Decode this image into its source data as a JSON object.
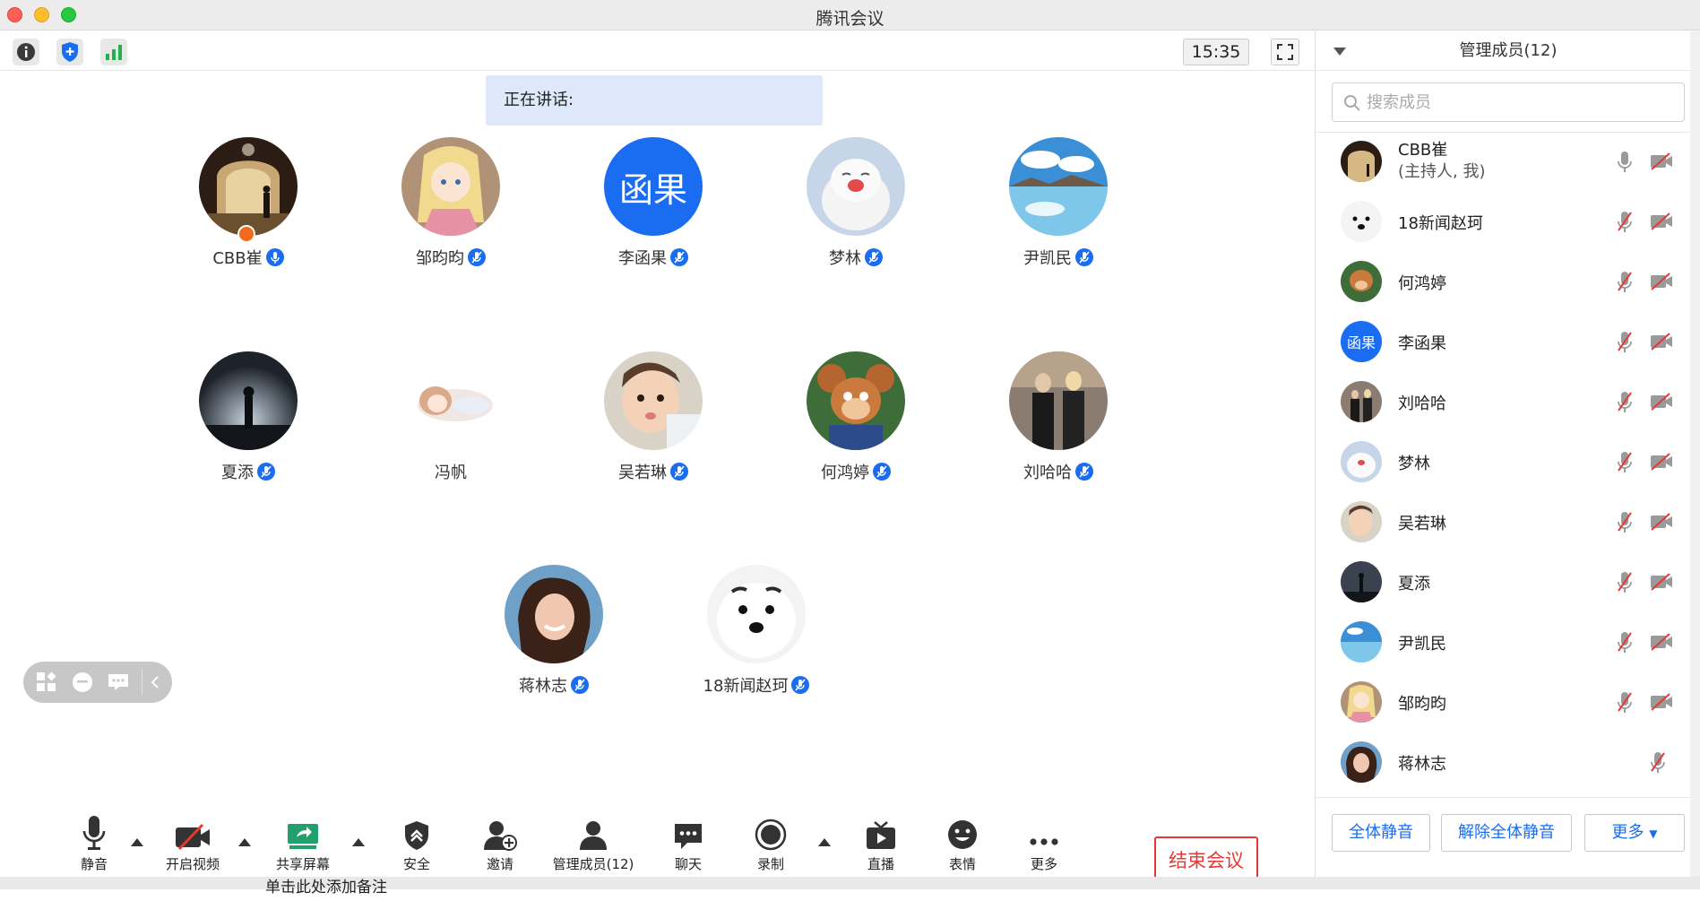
{
  "window": {
    "title": "腾讯会议"
  },
  "topbar": {
    "clock": "15:35",
    "icons": [
      "info-icon",
      "shield-icon",
      "signal-icon"
    ]
  },
  "speaking": {
    "label": "正在讲话:"
  },
  "participants": [
    {
      "name": "CBB崔",
      "avatar": "arch-photo",
      "host": true,
      "mic": "on"
    },
    {
      "name": "邹昀昀",
      "avatar": "anime-girl",
      "mic": "muted"
    },
    {
      "name": "李函果",
      "avatar_text": "函果",
      "avatar_color": "#1a6cf0",
      "mic": "muted"
    },
    {
      "name": "梦林",
      "avatar": "seal-photo",
      "mic": "muted"
    },
    {
      "name": "尹凯民",
      "avatar": "lake-photo",
      "mic": "muted"
    },
    {
      "name": "夏添",
      "avatar": "sunset-silhouette",
      "mic": "muted"
    },
    {
      "name": "冯帆",
      "avatar": "anime-lying",
      "mic": "none"
    },
    {
      "name": "吴若琳",
      "avatar": "child-photo",
      "mic": "muted"
    },
    {
      "name": "何鸿婷",
      "avatar": "jerry-mouse",
      "mic": "muted"
    },
    {
      "name": "刘哈哈",
      "avatar": "street-photo",
      "mic": "muted"
    },
    {
      "name": "蒋林志",
      "avatar": "smiling-woman",
      "mic": "muted"
    },
    {
      "name": "18新闻赵珂",
      "avatar": "white-dog",
      "mic": "muted"
    }
  ],
  "toolbar": {
    "mute": "静音",
    "video": "开启视频",
    "share": "共享屏幕",
    "security": "安全",
    "invite": "邀请",
    "members": "管理成员(12)",
    "chat": "聊天",
    "record": "录制",
    "live": "直播",
    "emoji": "表情",
    "more": "更多",
    "end": "结束会议"
  },
  "panel": {
    "title": "管理成员(12)",
    "search_placeholder": "搜索成员",
    "members": [
      {
        "name": "CBB崔",
        "sub": "(主持人, 我)",
        "avatar": "arch-photo"
      },
      {
        "name": "18新闻赵珂",
        "avatar": "white-dog"
      },
      {
        "name": "何鸿婷",
        "avatar": "jerry-mouse"
      },
      {
        "name": "李函果",
        "avatar_text": "函果"
      },
      {
        "name": "刘哈哈",
        "avatar": "street-photo"
      },
      {
        "name": "梦林",
        "avatar": "seal-photo"
      },
      {
        "name": "吴若琳",
        "avatar": "child-photo"
      },
      {
        "name": "夏添",
        "avatar": "sunset-silhouette"
      },
      {
        "name": "尹凯民",
        "avatar": "lake-photo"
      },
      {
        "name": "邹昀昀",
        "avatar": "anime-girl"
      },
      {
        "name": "蒋林志",
        "avatar": "smiling-woman"
      }
    ],
    "mute_all": "全体静音",
    "unmute_all": "解除全体静音",
    "more": "更多"
  },
  "background_text": "单击此处添加备注"
}
